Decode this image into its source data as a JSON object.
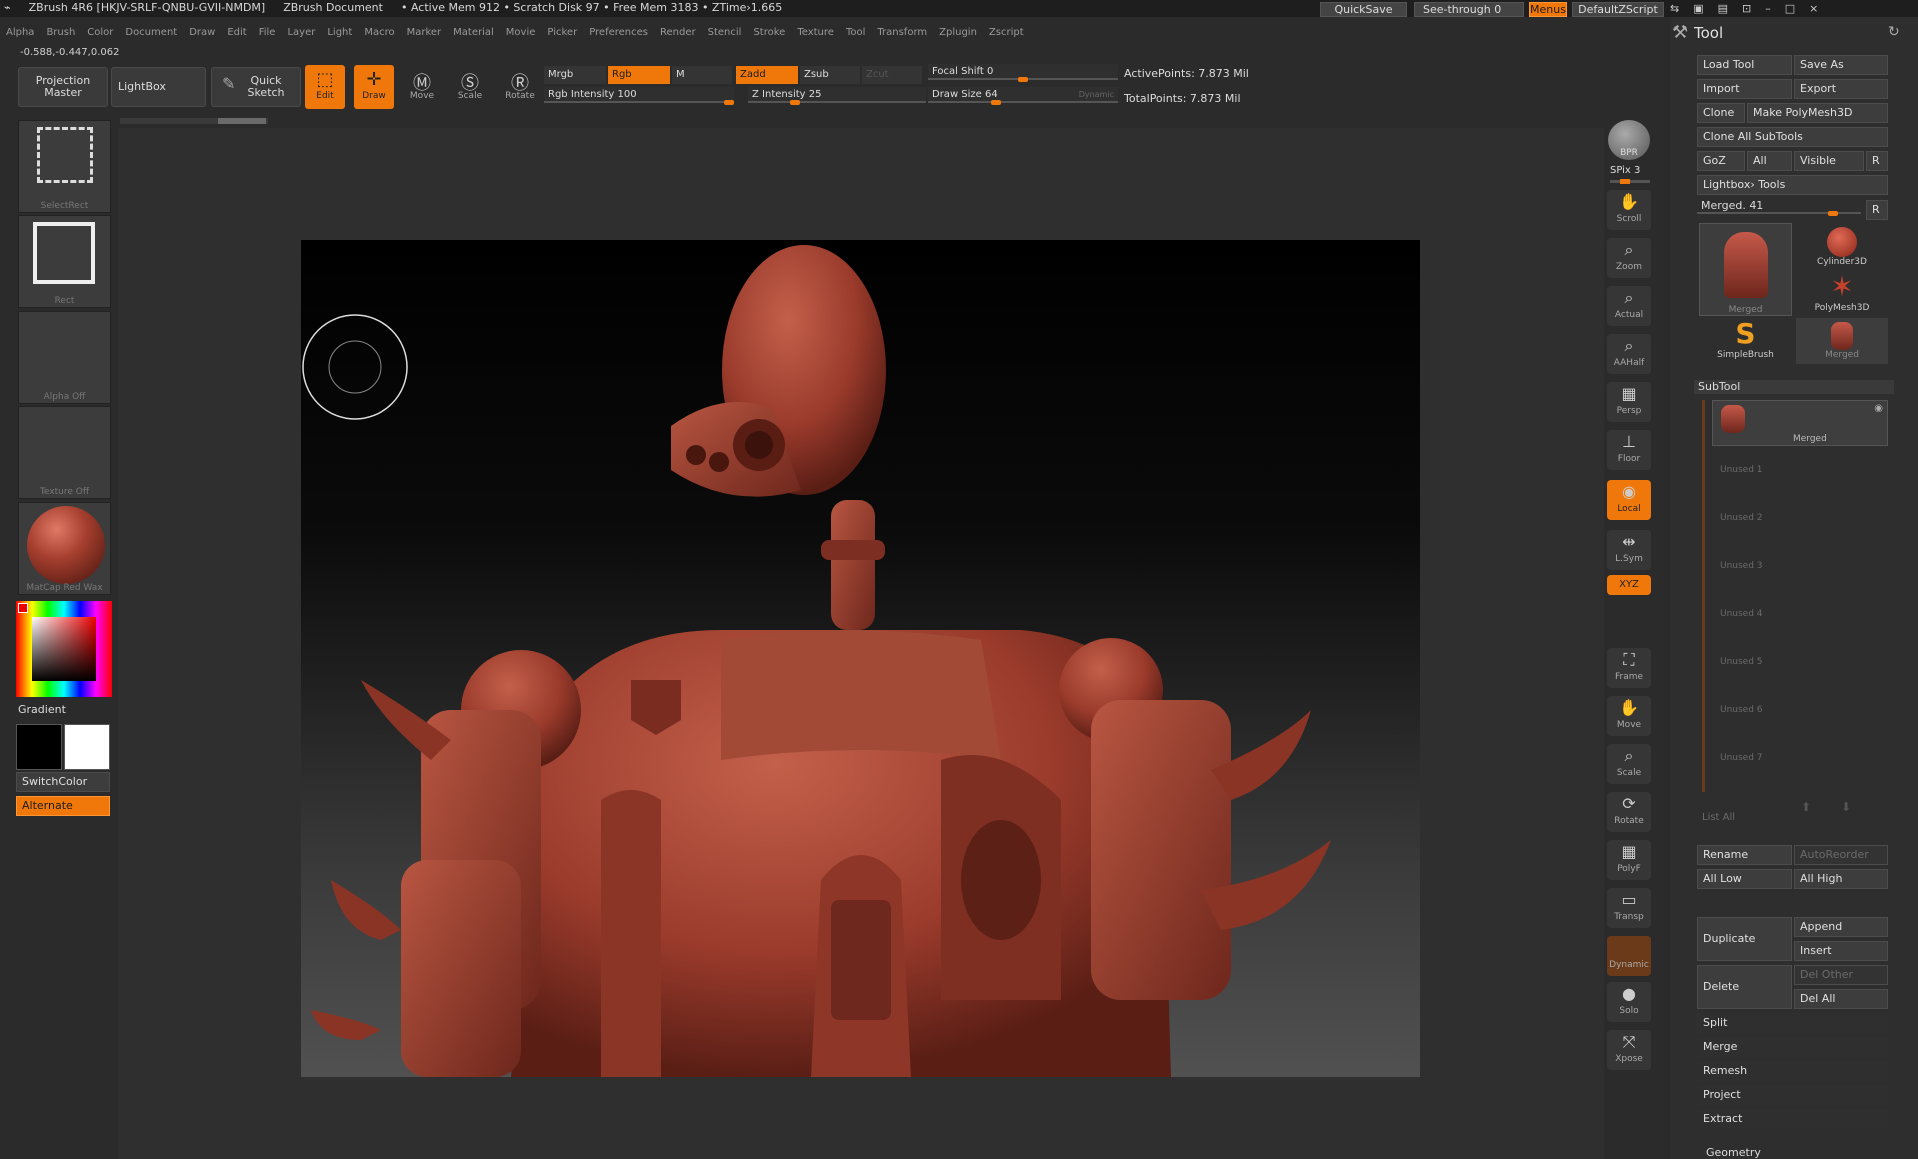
{
  "titlebar": {
    "app": "ZBrush 4R6 [HKJV-SRLF-QNBU-GVII-NMDM]",
    "document": "ZBrush Document",
    "stats": "• Active Mem 912 • Scratch Disk 97 • Free Mem 3183 • ZTime›1.665",
    "quicksave": "QuickSave",
    "see_through": "See-through",
    "see_through_value": "0",
    "menus": "Menus",
    "default_zscript": "DefaultZScript"
  },
  "menubar": [
    "Alpha",
    "Brush",
    "Color",
    "Document",
    "Draw",
    "Edit",
    "File",
    "Layer",
    "Light",
    "Macro",
    "Marker",
    "Material",
    "Movie",
    "Picker",
    "Preferences",
    "Render",
    "Stencil",
    "Stroke",
    "Texture",
    "Tool",
    "Transform",
    "Zplugin",
    "Zscript"
  ],
  "coords": "-0.588,-0.447,0.062",
  "shelf": {
    "projection_master": "Projection Master",
    "lightbox": "LightBox",
    "quick_sketch": "Quick Sketch",
    "edit": "Edit",
    "draw": "Draw",
    "move": "Move",
    "scale": "Scale",
    "rotate": "Rotate",
    "mrgb": "Mrgb",
    "rgb": "Rgb",
    "m": "M",
    "zadd": "Zadd",
    "zsub": "Zsub",
    "zcut": "Zcut",
    "rgb_intensity": "Rgb Intensity 100",
    "z_intensity": "Z Intensity 25",
    "focal_shift": "Focal Shift 0",
    "draw_size": "Draw Size 64",
    "dynamic": "Dynamic",
    "active_points": "ActivePoints: 7.873 Mil",
    "total_points": "TotalPoints: 7.873 Mil",
    "rgb_intensity_level": 1.0,
    "z_intensity_level": 0.25,
    "focal_shift_level": 0.5,
    "draw_size_level": 0.35
  },
  "left": {
    "select_rect": "SelectRect",
    "rect": "Rect",
    "alpha_off": "Alpha Off",
    "texture_off": "Texture Off",
    "matcap": "MatCap Red Wax",
    "gradient": "Gradient",
    "switch_color": "SwitchColor",
    "alternate": "Alternate"
  },
  "right_tools": [
    "BPR",
    "Scroll",
    "Zoom",
    "Actual",
    "AAHalf",
    "Persp",
    "Floor",
    "Local",
    "L.Sym",
    "XYZ",
    "Frame",
    "Move",
    "Scale",
    "Rotate",
    "PolyF",
    "Transp",
    "Dynamic",
    "Solo",
    "Xpose"
  ],
  "spix": "SPix 3",
  "toolpanel": {
    "title": "Tool",
    "load_tool": "Load Tool",
    "save_as": "Save As",
    "import": "Import",
    "export": "Export",
    "clone": "Clone",
    "make_polymesh": "Make PolyMesh3D",
    "clone_all": "Clone All SubTools",
    "goz": "GoZ",
    "all": "All",
    "visible": "Visible",
    "r": "R",
    "lightbox_tools": "Lightbox› Tools",
    "merged_slider": "Merged. 41",
    "merged_level": 0.85,
    "thumbs": [
      "Merged",
      "Cylinder3D",
      "PolyMesh3D",
      "SimpleBrush",
      "Merged"
    ],
    "subtool_title": "SubTool",
    "subtool_active": "Merged",
    "subtool_slots": [
      "Unused 1",
      "Unused 2",
      "Unused 3",
      "Unused 4",
      "Unused 5",
      "Unused 6",
      "Unused 7"
    ],
    "list_all": "List All",
    "rename": "Rename",
    "auto_reorder": "AutoReorder",
    "all_low": "All Low",
    "all_high": "All High",
    "duplicate": "Duplicate",
    "append": "Append",
    "insert": "Insert",
    "delete": "Delete",
    "del_other": "Del Other",
    "del_all": "Del All",
    "split": "Split",
    "merge": "Merge",
    "remesh": "Remesh",
    "project": "Project",
    "extract": "Extract",
    "geometry": "Geometry"
  },
  "colors": {
    "accent": "#f0780a",
    "model": "#9b3b2c"
  }
}
